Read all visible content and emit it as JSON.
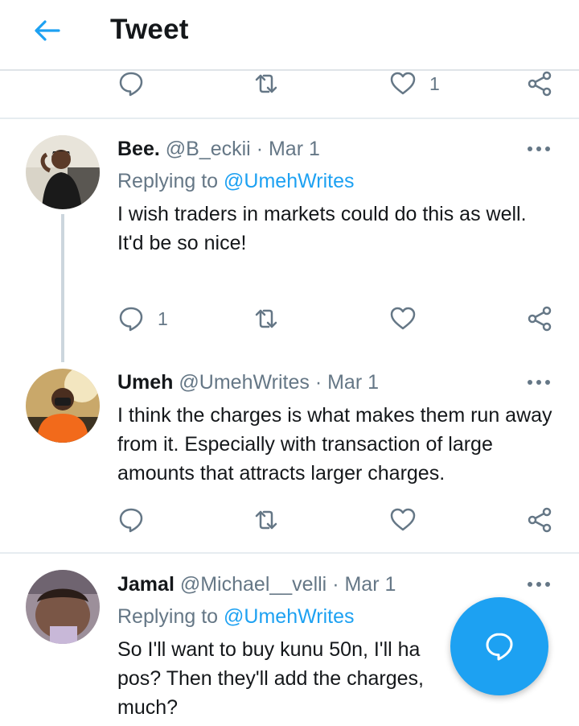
{
  "header": {
    "title": "Tweet",
    "back_icon": "arrow-left-icon",
    "accent": "#1da1f2"
  },
  "top_actions": {
    "like_count": "1"
  },
  "tweets": [
    {
      "name": "Bee.",
      "handle": "@B_eckii",
      "separator": "·",
      "date": "Mar 1",
      "replying_prefix": "Replying to",
      "replying_to": "@UmehWrites",
      "text": [
        "I wish traders in markets could do this as well.",
        "It'd be so nice!"
      ],
      "reply_count": "1"
    },
    {
      "name": "Umeh",
      "handle": "@UmehWrites",
      "separator": "·",
      "date": "Mar 1",
      "text": [
        "I think the charges is what makes them run away from it. Especially with transaction of large amounts that attracts larger charges."
      ]
    },
    {
      "name": "Jamal",
      "handle": "@Michael__velli",
      "separator": "·",
      "date": "Mar 1",
      "replying_prefix": "Replying to",
      "replying_to": "@UmehWrites",
      "text": [
        "So I'll want to buy kunu 50n, I'll ha",
        "pos? Then they'll add the charges, ",
        "much?"
      ]
    }
  ],
  "icons": {
    "reply": "reply-bubble-icon",
    "retweet": "retweet-icon",
    "like": "heart-icon",
    "share": "share-icon",
    "more": "more-dots-icon",
    "compose": "compose-reply-icon"
  }
}
